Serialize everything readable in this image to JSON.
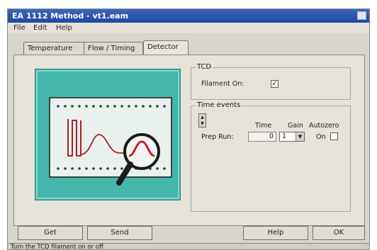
{
  "window": {
    "title": "EA 1112 Method - vt1.eam"
  },
  "menu": {
    "items": [
      "File",
      "Edit",
      "Help"
    ]
  },
  "tabs": [
    {
      "label": "Temperature",
      "active": false
    },
    {
      "label": "Flow / Timing",
      "active": false
    },
    {
      "label": "Detector",
      "active": true
    }
  ],
  "tcd": {
    "group_label": "TCD",
    "filament_label": "Filament On:",
    "filament_checked": true,
    "check_mark": "✓"
  },
  "time_events": {
    "group_label": "Time events",
    "col_time": "Time",
    "col_gain": "Gain",
    "col_autozero": "Autozero",
    "row_label": "Prep Run:",
    "time_value": "0",
    "gain_value": "1",
    "autozero_value": "On"
  },
  "buttons": {
    "get": "Get",
    "send": "Send",
    "help": "Help",
    "ok": "OK"
  },
  "status": {
    "text": "Turn the TCD filament on or off"
  },
  "colors": {
    "title_bar": "#1d48a0",
    "illustration_bg": "#45b6aa",
    "signal_wave": "#cc1f1f"
  },
  "icons": {
    "spin_up": "spin-up-icon",
    "spin_down": "spin-down-icon",
    "combo_arrow": "chevron-down-icon",
    "magnifier": "magnifier-icon"
  }
}
